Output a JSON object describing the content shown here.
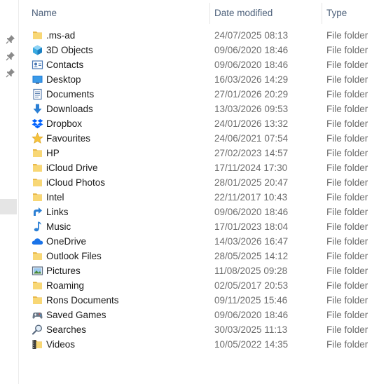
{
  "columns": {
    "name": "Name",
    "date": "Date modified",
    "type": "Type"
  },
  "rows": [
    {
      "name": ".ms-ad",
      "date": "24/07/2025 08:13",
      "type": "File folder",
      "icon": "folder-icon"
    },
    {
      "name": "3D Objects",
      "date": "09/06/2020 18:46",
      "type": "File folder",
      "icon": "3d-objects-icon"
    },
    {
      "name": "Contacts",
      "date": "09/06/2020 18:46",
      "type": "File folder",
      "icon": "contacts-icon"
    },
    {
      "name": "Desktop",
      "date": "16/03/2026 14:29",
      "type": "File folder",
      "icon": "desktop-icon"
    },
    {
      "name": "Documents",
      "date": "27/01/2026 20:29",
      "type": "File folder",
      "icon": "documents-icon"
    },
    {
      "name": "Downloads",
      "date": "13/03/2026 09:53",
      "type": "File folder",
      "icon": "downloads-icon"
    },
    {
      "name": "Dropbox",
      "date": "24/01/2026 13:32",
      "type": "File folder",
      "icon": "dropbox-icon"
    },
    {
      "name": "Favourites",
      "date": "24/06/2021 07:54",
      "type": "File folder",
      "icon": "star-icon"
    },
    {
      "name": "HP",
      "date": "27/02/2023 14:57",
      "type": "File folder",
      "icon": "folder-icon"
    },
    {
      "name": "iCloud Drive",
      "date": "17/11/2024 17:30",
      "type": "File folder",
      "icon": "folder-icon"
    },
    {
      "name": "iCloud Photos",
      "date": "28/01/2025 20:47",
      "type": "File folder",
      "icon": "folder-icon"
    },
    {
      "name": "Intel",
      "date": "22/11/2017 10:43",
      "type": "File folder",
      "icon": "folder-icon"
    },
    {
      "name": "Links",
      "date": "09/06/2020 18:46",
      "type": "File folder",
      "icon": "links-icon"
    },
    {
      "name": "Music",
      "date": "17/01/2023 18:04",
      "type": "File folder",
      "icon": "music-icon"
    },
    {
      "name": "OneDrive",
      "date": "14/03/2026 16:47",
      "type": "File folder",
      "icon": "onedrive-icon"
    },
    {
      "name": "Outlook Files",
      "date": "28/05/2025 14:12",
      "type": "File folder",
      "icon": "folder-icon"
    },
    {
      "name": "Pictures",
      "date": "11/08/2025 09:28",
      "type": "File folder",
      "icon": "pictures-icon"
    },
    {
      "name": "Roaming",
      "date": "02/05/2017 20:53",
      "type": "File folder",
      "icon": "folder-icon"
    },
    {
      "name": "Rons Documents",
      "date": "09/11/2025 15:46",
      "type": "File folder",
      "icon": "folder-icon"
    },
    {
      "name": "Saved Games",
      "date": "09/06/2020 18:46",
      "type": "File folder",
      "icon": "saved-games-icon"
    },
    {
      "name": "Searches",
      "date": "30/03/2025 11:13",
      "type": "File folder",
      "icon": "search-icon"
    },
    {
      "name": "Videos",
      "date": "10/05/2022 14:35",
      "type": "File folder",
      "icon": "videos-icon"
    }
  ],
  "colors": {
    "folder": "#f8d775",
    "header_text": "#4c607a",
    "secondary_text": "#6d6d6d",
    "accent_blue": "#1e7ad6"
  }
}
